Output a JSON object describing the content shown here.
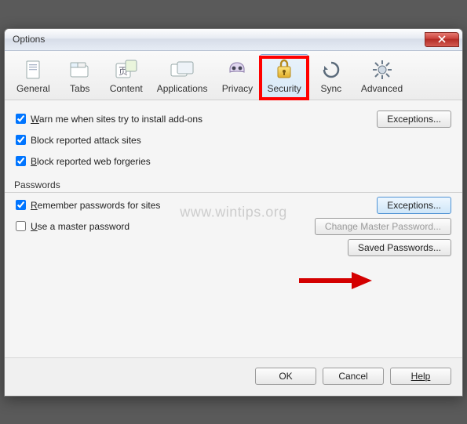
{
  "window": {
    "title": "Options"
  },
  "toolbar": {
    "items": [
      {
        "id": "general",
        "label": "General"
      },
      {
        "id": "tabs",
        "label": "Tabs"
      },
      {
        "id": "content",
        "label": "Content"
      },
      {
        "id": "applications",
        "label": "Applications"
      },
      {
        "id": "privacy",
        "label": "Privacy"
      },
      {
        "id": "security",
        "label": "Security",
        "active": true,
        "highlighted": true
      },
      {
        "id": "sync",
        "label": "Sync"
      },
      {
        "id": "advanced",
        "label": "Advanced"
      }
    ]
  },
  "security": {
    "warn_addons": {
      "label": "Warn me when sites try to install add-ons",
      "checked": true
    },
    "block_attack": {
      "label": "Block reported attack sites",
      "checked": true
    },
    "block_forgeries": {
      "label": "Block reported web forgeries",
      "checked": true
    },
    "exceptions_top": "Exceptions...",
    "passwords_heading": "Passwords",
    "remember_pw": {
      "label": "Remember passwords for sites",
      "checked": true
    },
    "master_pw": {
      "label": "Use a master password",
      "checked": false
    },
    "exceptions_pw": "Exceptions...",
    "change_master": "Change Master Password...",
    "saved_pw": "Saved Passwords..."
  },
  "footer": {
    "ok": "OK",
    "cancel": "Cancel",
    "help": "Help"
  },
  "watermark": "www.wintips.org"
}
